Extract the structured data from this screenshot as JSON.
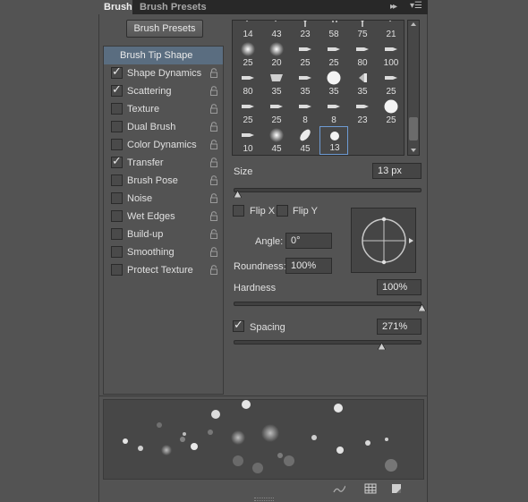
{
  "tabs": {
    "active": "Brush",
    "inactive": "Brush Presets"
  },
  "presets_button": "Brush Presets",
  "brush_tip_shape": "Brush Tip Shape",
  "options": [
    {
      "label": "Shape Dynamics",
      "checked": true
    },
    {
      "label": "Scattering",
      "checked": true
    },
    {
      "label": "Texture",
      "checked": false
    },
    {
      "label": "Dual Brush",
      "checked": false
    },
    {
      "label": "Color Dynamics",
      "checked": false
    },
    {
      "label": "Transfer",
      "checked": true
    },
    {
      "label": "Brush Pose",
      "checked": false
    },
    {
      "label": "Noise",
      "checked": false
    },
    {
      "label": "Wet Edges",
      "checked": false
    },
    {
      "label": "Build-up",
      "checked": false
    },
    {
      "label": "Smoothing",
      "checked": false
    },
    {
      "label": "Protect Texture",
      "checked": false
    }
  ],
  "brush_grid": [
    {
      "size": "14",
      "kind": "spatter"
    },
    {
      "size": "43",
      "kind": "spatter"
    },
    {
      "size": "23",
      "kind": "star"
    },
    {
      "size": "58",
      "kind": "mesh"
    },
    {
      "size": "75",
      "kind": "star"
    },
    {
      "size": "21",
      "kind": "spatter"
    },
    {
      "size": "25",
      "kind": "soft"
    },
    {
      "size": "20",
      "kind": "soft"
    },
    {
      "size": "25",
      "kind": "tip"
    },
    {
      "size": "25",
      "kind": "tip"
    },
    {
      "size": "80",
      "kind": "tip"
    },
    {
      "size": "100",
      "kind": "tip"
    },
    {
      "size": "80",
      "kind": "tip"
    },
    {
      "size": "35",
      "kind": "wedge"
    },
    {
      "size": "35",
      "kind": "tip"
    },
    {
      "size": "35",
      "kind": "hard"
    },
    {
      "size": "35",
      "kind": "cone"
    },
    {
      "size": "25",
      "kind": "tip"
    },
    {
      "size": "25",
      "kind": "tip"
    },
    {
      "size": "25",
      "kind": "tip"
    },
    {
      "size": "8",
      "kind": "tip"
    },
    {
      "size": "8",
      "kind": "tip"
    },
    {
      "size": "23",
      "kind": "tip"
    },
    {
      "size": "25",
      "kind": "hard"
    },
    {
      "size": "10",
      "kind": "tip"
    },
    {
      "size": "45",
      "kind": "soft"
    },
    {
      "size": "45",
      "kind": "leaf"
    },
    {
      "size": "13",
      "kind": "hard-small",
      "selected": true
    }
  ],
  "size": {
    "label": "Size",
    "value": "13 px",
    "level": 0.02
  },
  "flip_x": {
    "label": "Flip X",
    "checked": false
  },
  "flip_y": {
    "label": "Flip Y",
    "checked": false
  },
  "angle": {
    "label": "Angle:",
    "value": "0°"
  },
  "roundness": {
    "label": "Roundness:",
    "value": "100%"
  },
  "hardness": {
    "label": "Hardness",
    "value": "100%",
    "level": 1.0
  },
  "spacing": {
    "label": "Spacing",
    "value": "271%",
    "checked": true,
    "level": 0.79
  },
  "colors": {
    "panel": "#535353",
    "selection": "#5a6d80",
    "selected_brush_border": "#6e9bd4"
  },
  "icons": [
    "lock-icon",
    "angle-crosshair-icon",
    "brush-stroke-icon",
    "grid-icon",
    "new-preset-icon",
    "panel-menu-icon",
    "collapse-icon"
  ]
}
